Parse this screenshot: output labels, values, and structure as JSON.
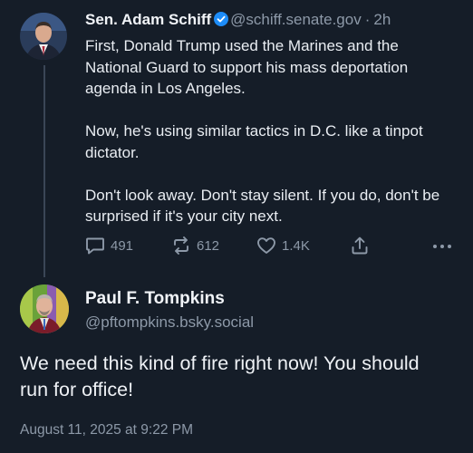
{
  "post1": {
    "author_name": "Sen. Adam Schiff",
    "handle": "@schiff.senate.gov",
    "separator": "·",
    "time_ago": "2h",
    "paragraphs": [
      "First, Donald Trump used the Marines and the National Guard to support his mass deportation agenda in Los Angeles.",
      "Now, he's using similar tactics in D.C. like a tinpot dictator.",
      "Don't look away. Don't stay silent. If you do, don't be surprised if it's your city next."
    ],
    "actions": {
      "replies": "491",
      "reposts": "612",
      "likes": "1.4K"
    },
    "verified_color": "#1d8cf8"
  },
  "post2": {
    "author_name": "Paul F. Tompkins",
    "handle": "@pftompkins.bsky.social",
    "text": "We need this kind of fire right now! You should run for office!",
    "timestamp": "August 11, 2025 at 9:22 PM"
  },
  "theme": {
    "background": "#151d28",
    "muted_text": "#8d99a8",
    "thread_line": "#3a4656"
  }
}
